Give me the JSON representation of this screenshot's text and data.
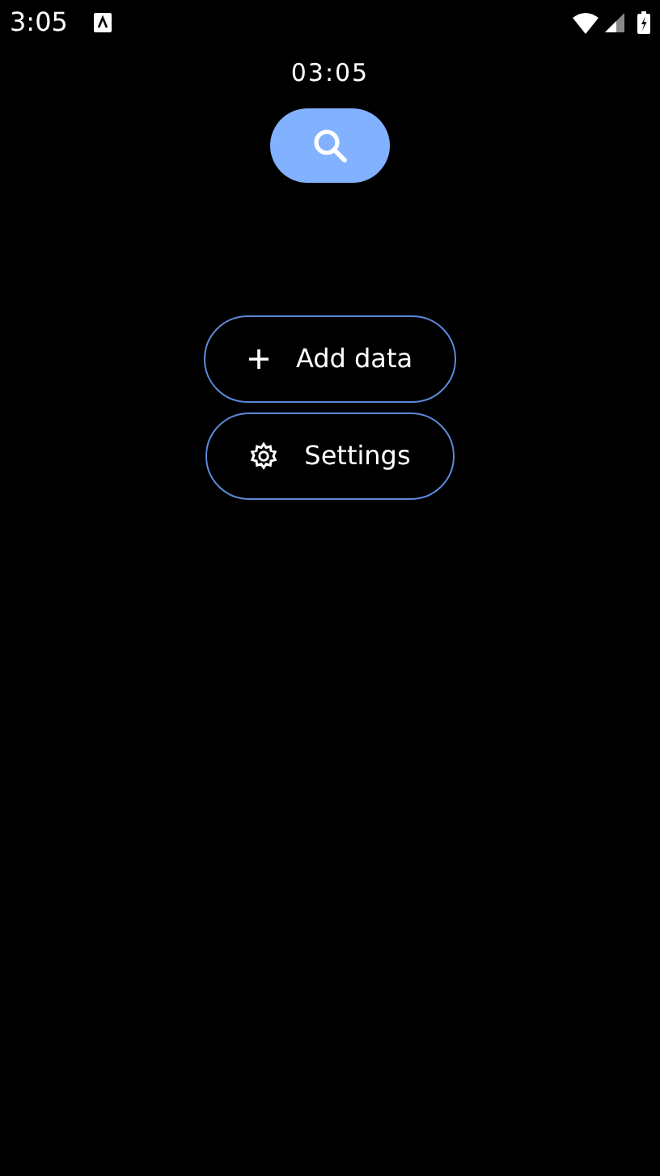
{
  "status_bar": {
    "time": "3:05"
  },
  "clock": "03:05",
  "buttons": [
    {
      "kind": "add",
      "label": "Add data"
    },
    {
      "kind": "settings",
      "label": "Settings"
    }
  ]
}
